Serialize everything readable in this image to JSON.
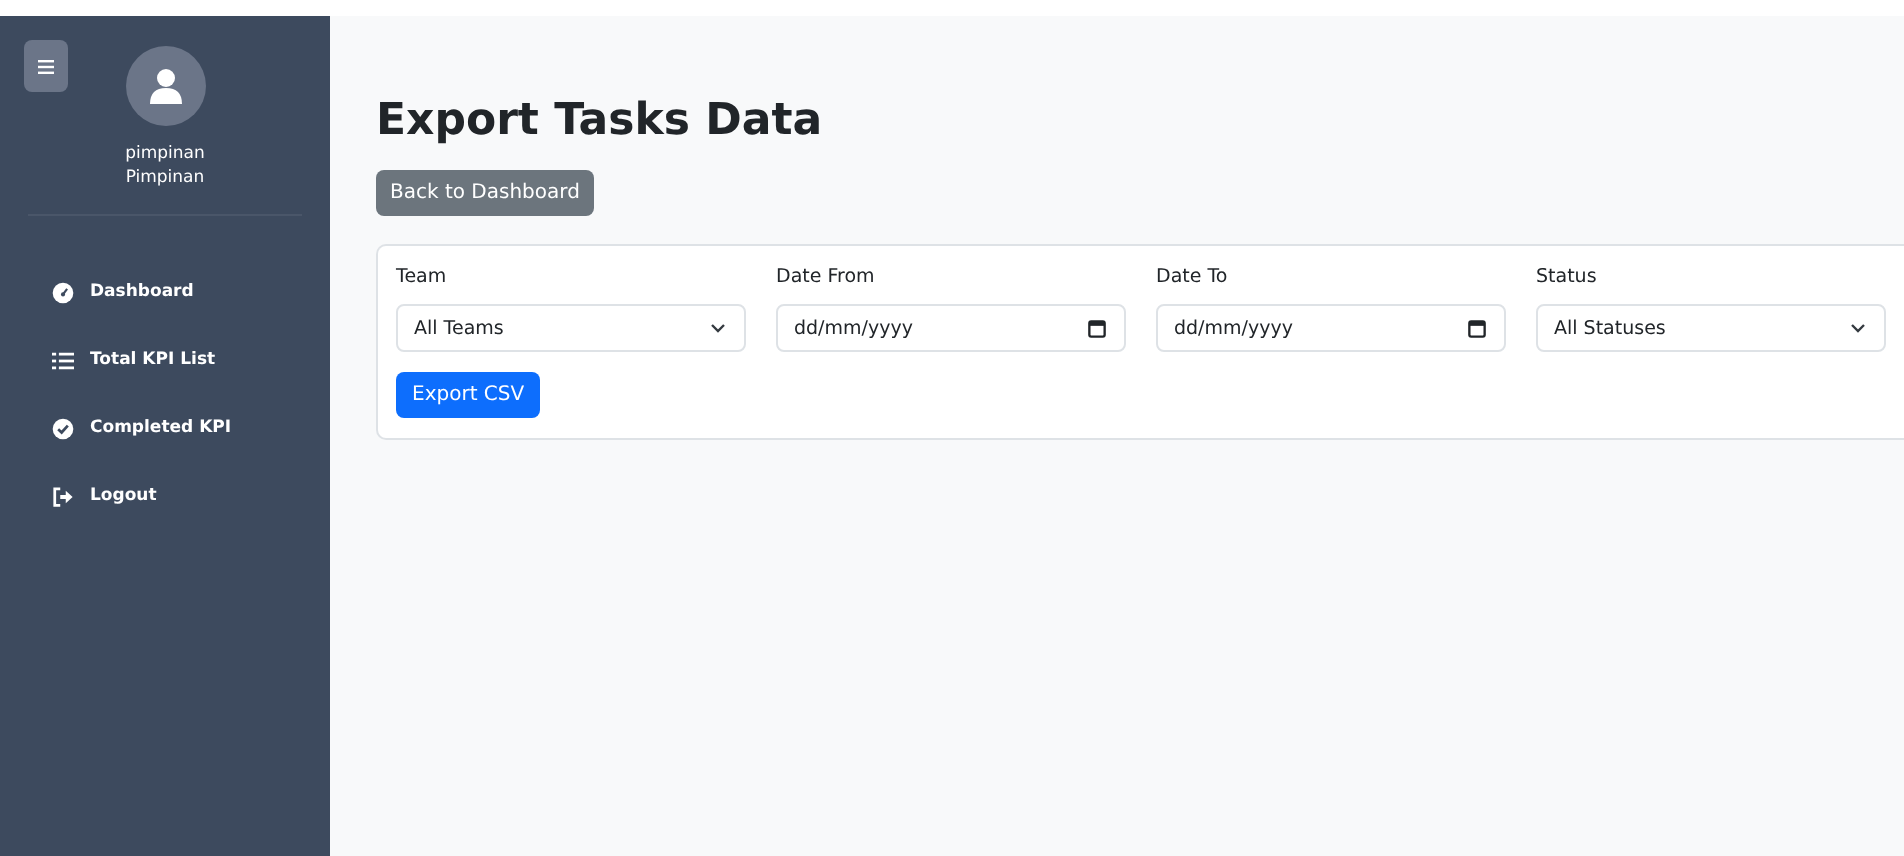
{
  "user": {
    "username": "pimpinan",
    "role": "Pimpinan"
  },
  "nav": [
    {
      "label": "Dashboard",
      "kind": "gauge"
    },
    {
      "label": "Total KPI List",
      "kind": "list"
    },
    {
      "label": "Completed KPI",
      "kind": "check"
    },
    {
      "label": "Logout",
      "kind": "logout"
    }
  ],
  "page": {
    "title": "Export Tasks Data",
    "back_button": "Back to Dashboard"
  },
  "filters": [
    {
      "label": "Team",
      "kind": "select",
      "value": "All Teams"
    },
    {
      "label": "Date From",
      "kind": "date",
      "placeholder": "dd/mm/yyyy"
    },
    {
      "label": "Date To",
      "kind": "date",
      "placeholder": "dd/mm/yyyy"
    },
    {
      "label": "Status",
      "kind": "select",
      "value": "All Statuses"
    }
  ],
  "export_button": "Export CSV"
}
